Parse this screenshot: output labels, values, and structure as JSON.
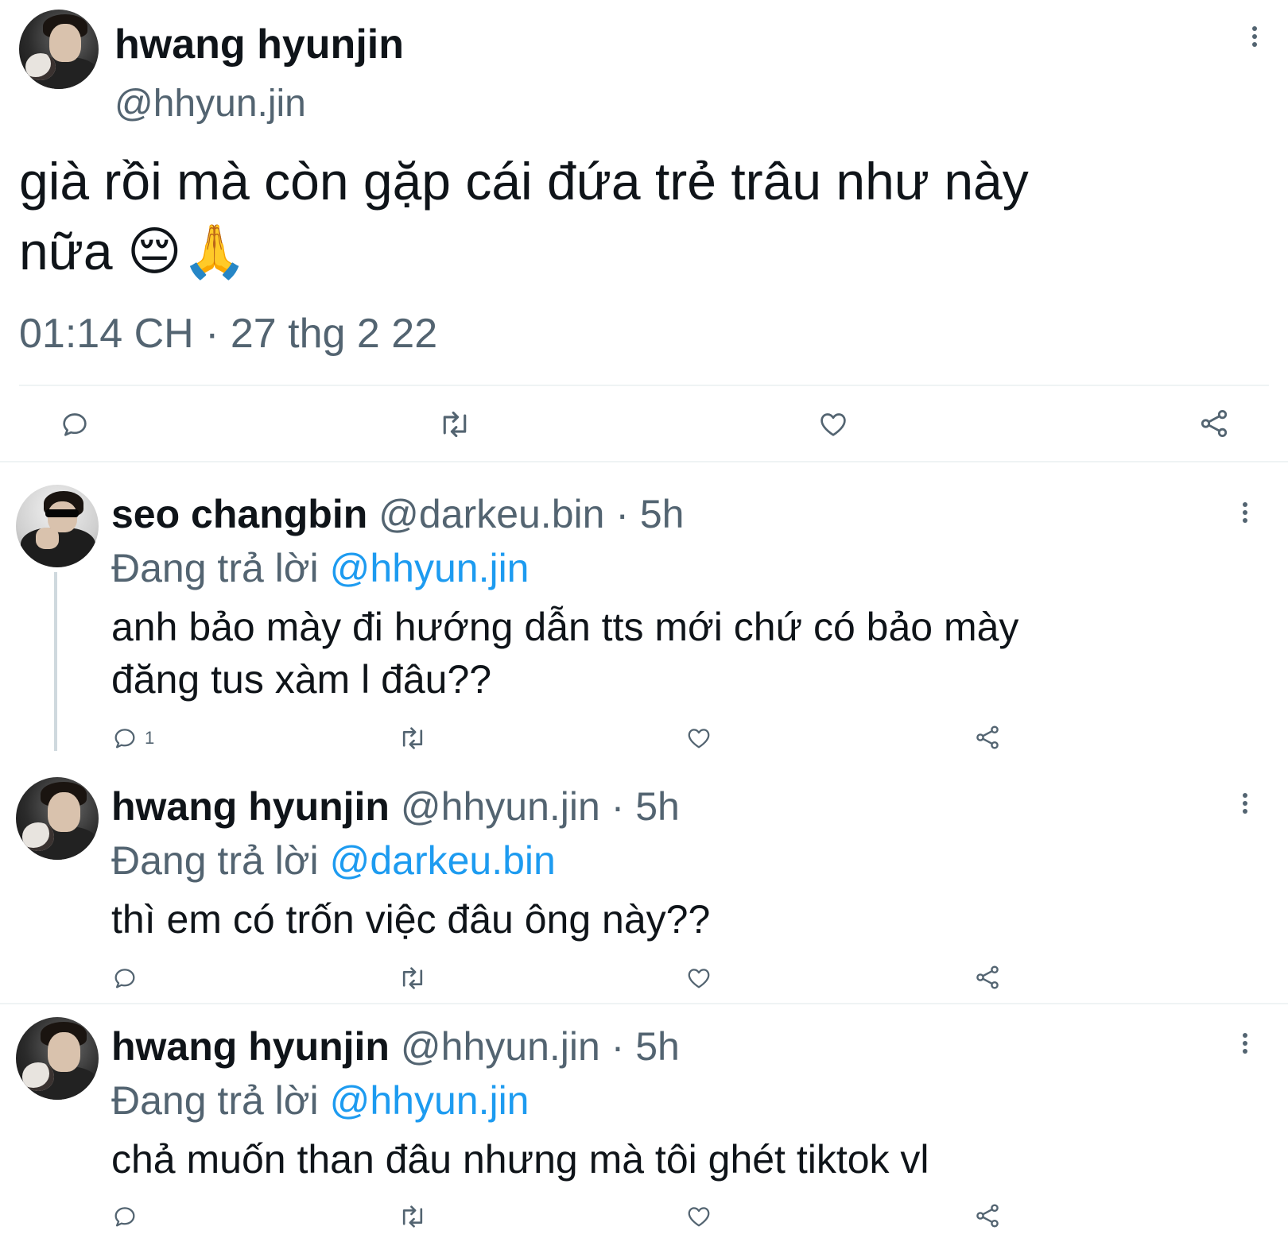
{
  "main_tweet": {
    "display_name": "hwang hyunjin",
    "handle": "@hhyun.jin",
    "text_line1": "già rồi mà còn gặp cái đứa trẻ trâu như này",
    "text_line2": "nữa 😔🙏",
    "timestamp": "01:14 CH · 27 thg 2 22"
  },
  "replies": [
    {
      "display_name": "seo changbin",
      "meta": "@darkeu.bin · 5h",
      "replying_prefix": "Đang trả lời",
      "replying_to": "@hhyun.jin",
      "text_line1": "anh bảo mày đi hướng dẫn tts mới chứ có bảo mày",
      "text_line2": "đăng tus xàm l đâu??",
      "reply_count": "1"
    },
    {
      "display_name": "hwang hyunjin",
      "meta": "@hhyun.jin · 5h",
      "replying_prefix": "Đang trả lời",
      "replying_to": "@darkeu.bin",
      "text_line1": "thì em có trốn việc đâu ông này??"
    },
    {
      "display_name": "hwang hyunjin",
      "meta": "@hhyun.jin · 5h",
      "replying_prefix": "Đang trả lời",
      "replying_to": "@hhyun.jin",
      "text_line1": "chả muốn than đâu nhưng mà tôi ghét tiktok vl"
    }
  ],
  "colors": {
    "text": "#0f1419",
    "secondary": "#536471",
    "link": "#1d9bf0",
    "divider": "#eff3f4"
  },
  "icons": [
    "reply-icon",
    "retweet-icon",
    "like-icon",
    "share-icon",
    "more-icon"
  ]
}
